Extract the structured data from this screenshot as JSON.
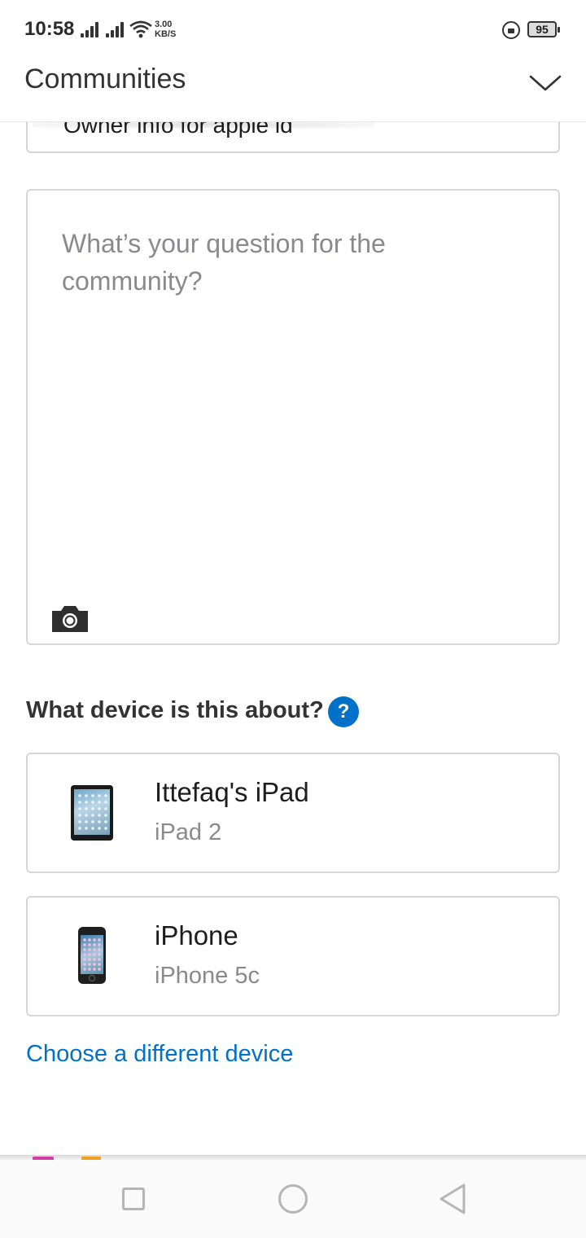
{
  "status_bar": {
    "time": "10:58",
    "net_speed_value": "3.00",
    "net_speed_unit": "KB/S",
    "battery": "95"
  },
  "header": {
    "title": "Communities"
  },
  "subject": {
    "value": "Owner info for apple id"
  },
  "question": {
    "placeholder": "What’s your question for the community?"
  },
  "device_section": {
    "heading": "What device is this about?",
    "help_symbol": "?",
    "devices": [
      {
        "name": "Ittefaq's iPad",
        "model": "iPad 2",
        "icon": "ipad-icon"
      },
      {
        "name": "iPhone",
        "model": "iPhone 5c",
        "icon": "iphone-icon"
      }
    ],
    "choose_link": "Choose a different device"
  },
  "colors": {
    "accent": "#0070c9",
    "placeholder": "#8a8a8e",
    "border": "#d6d6d6"
  }
}
